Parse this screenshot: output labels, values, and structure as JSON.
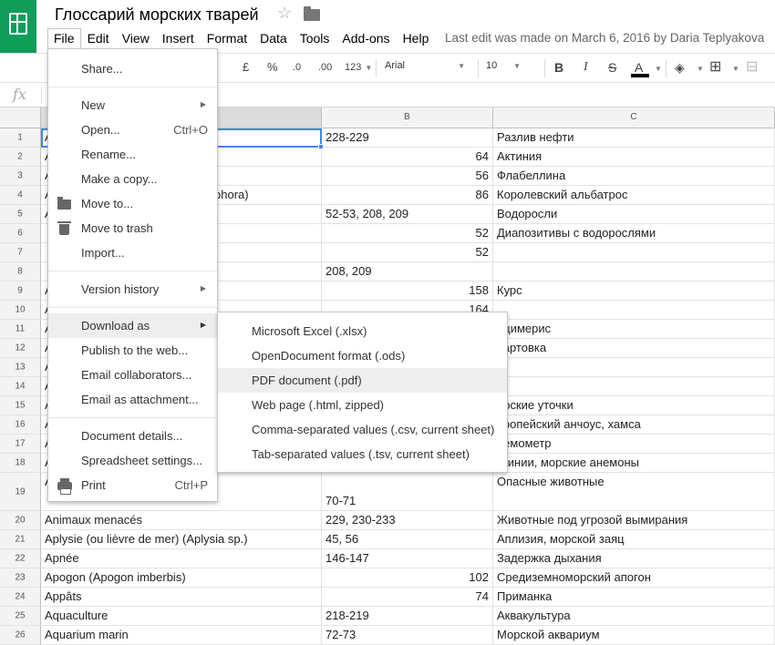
{
  "doc": {
    "title": "Глоссарий морских тварей",
    "last_edit": "Last edit was made on March 6, 2016 by Daria Teplyakova"
  },
  "menubar": [
    "File",
    "Edit",
    "View",
    "Insert",
    "Format",
    "Data",
    "Tools",
    "Add-ons",
    "Help"
  ],
  "toolbar": {
    "currency": "£",
    "percent": "%",
    "dec_decrease": ".0",
    "dec_increase": ".00",
    "more_formats": "123",
    "font": "Arial",
    "font_size": "10",
    "bold": "B",
    "italic": "I",
    "strike": "S",
    "text_color": "A"
  },
  "formula_bar": {
    "fx": "fx",
    "value": ""
  },
  "columns": [
    "B",
    "C"
  ],
  "rows": [
    {
      "n": "1",
      "a": "A",
      "b": "228-229",
      "b_num": false,
      "c": "Разлив нефти"
    },
    {
      "n": "2",
      "a": "A",
      "b": "64",
      "b_num": true,
      "c": "Актиния"
    },
    {
      "n": "3",
      "a": "A",
      "b": "56",
      "b_num": true,
      "c": "Флабеллина"
    },
    {
      "n": "4",
      "a": "A",
      "a_tail": "phora)",
      "b": "86",
      "b_num": true,
      "c": "Королевский альбатрос"
    },
    {
      "n": "5",
      "a": "A",
      "b": "52-53, 208, 209",
      "b_num": false,
      "c": "Водоросли"
    },
    {
      "n": "6",
      "a": "",
      "b": "52",
      "b_num": true,
      "c": "Диапозитивы с водорослями"
    },
    {
      "n": "7",
      "a": "",
      "b": "52",
      "b_num": true,
      "c": ""
    },
    {
      "n": "8",
      "a": "",
      "b": "208, 209",
      "b_num": false,
      "c": ""
    },
    {
      "n": "9",
      "a": "A",
      "b": "158",
      "b_num": true,
      "c": "Курс"
    },
    {
      "n": "10",
      "a": "A",
      "b": "164",
      "b_num": true,
      "c": ""
    },
    {
      "n": "11",
      "a": "A",
      "b": "",
      "b_num": false,
      "c": "ицимерис"
    },
    {
      "n": "12",
      "a": "A",
      "b": "",
      "b_num": false,
      "c": "вартовка"
    },
    {
      "n": "13",
      "a": "A",
      "b": "",
      "b_num": false,
      "c": ""
    },
    {
      "n": "14",
      "a": "A",
      "b": "",
      "b_num": false,
      "c": ""
    },
    {
      "n": "15",
      "a": "A",
      "b": "",
      "b_num": false,
      "c": "орские уточки"
    },
    {
      "n": "16",
      "a": "A",
      "b": "",
      "b_num": false,
      "c": "вропейский анчоус, хамса"
    },
    {
      "n": "17",
      "a": "A",
      "b": "",
      "b_num": false,
      "c": "немометр"
    },
    {
      "n": "18",
      "a": "A",
      "b": "",
      "b_num": false,
      "c": "ктинии, морские анемоны"
    },
    {
      "n": "19",
      "a": "A",
      "b": "70-71",
      "b_num": false,
      "c": "Опасные животные",
      "tall": true
    },
    {
      "n": "20",
      "a": "Animaux menacés",
      "b": "229, 230-233",
      "b_num": false,
      "c": "Животные под угрозой вымирания"
    },
    {
      "n": "21",
      "a": "Aplysie (ou lièvre de mer) (Aplysia sp.)",
      "b": "45, 56",
      "b_num": false,
      "c": "Аплизия, морской заяц"
    },
    {
      "n": "22",
      "a": "Apnée",
      "b": "146-147",
      "b_num": false,
      "c": "Задержка дыхания"
    },
    {
      "n": "23",
      "a": "Apogon (Apogon imberbis)",
      "b": "102",
      "b_num": true,
      "c": "Средиземноморский апогон"
    },
    {
      "n": "24",
      "a": "Appâts",
      "b": "74",
      "b_num": true,
      "c": "Приманка"
    },
    {
      "n": "25",
      "a": "Aquaculture",
      "b": "218-219",
      "b_num": false,
      "c": "Аквакультура"
    },
    {
      "n": "26",
      "a": "Aquarium marin",
      "b": "72-73",
      "b_num": false,
      "c": "Морской аквариум"
    }
  ],
  "file_menu": {
    "share": "Share...",
    "new": "New",
    "open": "Open...",
    "open_shortcut": "Ctrl+O",
    "rename": "Rename...",
    "make_copy": "Make a copy...",
    "move_to": "Move to...",
    "move_trash": "Move to trash",
    "import": "Import...",
    "version_history": "Version history",
    "download_as": "Download as",
    "publish": "Publish to the web...",
    "email_collab": "Email collaborators...",
    "email_attach": "Email as attachment...",
    "doc_details": "Document details...",
    "sheet_settings": "Spreadsheet settings...",
    "print": "Print",
    "print_shortcut": "Ctrl+P"
  },
  "download_submenu": [
    "Microsoft Excel (.xlsx)",
    "OpenDocument format (.ods)",
    "PDF document (.pdf)",
    "Web page (.html, zipped)",
    "Comma-separated values (.csv, current sheet)",
    "Tab-separated values (.tsv, current sheet)"
  ],
  "colors": {
    "brand": "#0f9d58",
    "selection": "#4285f4",
    "highlight": "#eeeeee"
  }
}
